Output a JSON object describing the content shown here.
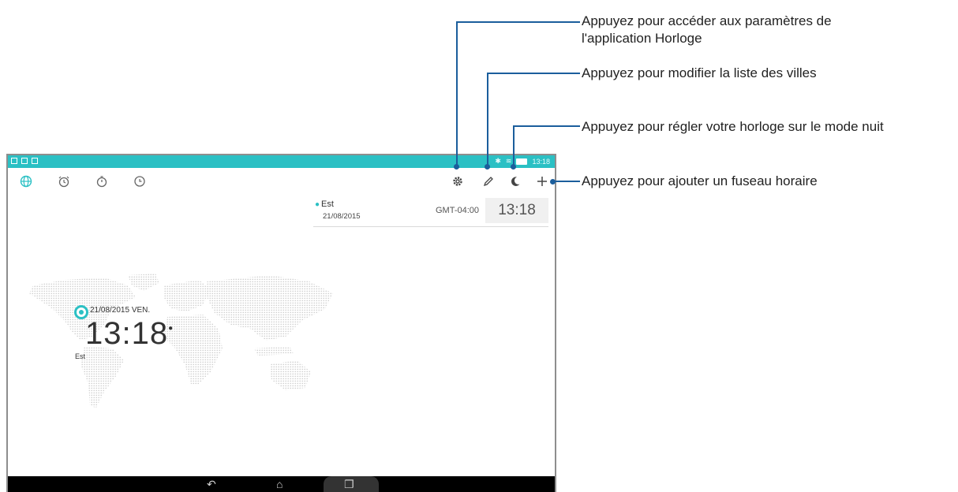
{
  "statusbar": {
    "time": "13:18"
  },
  "toolbar": {
    "tabs": [
      {
        "name": "world-clock",
        "icon": "globe-icon",
        "active": true
      },
      {
        "name": "alarm",
        "icon": "alarm-icon"
      },
      {
        "name": "stopwatch",
        "icon": "stopwatch-icon"
      },
      {
        "name": "timer",
        "icon": "timer-icon"
      }
    ],
    "actions": [
      "settings-icon",
      "edit-icon",
      "night-mode-icon",
      "add-icon"
    ]
  },
  "city": {
    "name": "Est",
    "date": "21/08/2015",
    "gmt": "GMT-04:00",
    "time": "13:18"
  },
  "local": {
    "date": "21/08/2015 VEN.",
    "time": "13:18",
    "city": "Est"
  },
  "callouts": {
    "settings": [
      "Appuyez pour accéder aux paramètres de",
      "l'application Horloge"
    ],
    "edit": "Appuyez pour modifier la liste des villes",
    "night": "Appuyez pour régler votre horloge sur le mode nuit",
    "add": "Appuyez pour ajouter un fuseau horaire"
  },
  "colors": {
    "accent": "#2bc0c4",
    "callout": "#1b5e9c"
  }
}
